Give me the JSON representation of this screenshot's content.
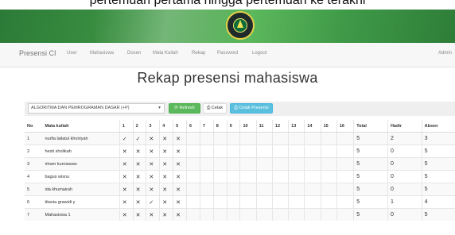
{
  "header": {
    "partial_text": "pertemuan pertama hingga pertemuan ke terakhi"
  },
  "navbar": {
    "brand": "Presensi CI",
    "items": [
      "User",
      "Mahasiswa",
      "Dosen",
      "Mata Kuliah",
      "Rekap",
      "Password",
      "Logout"
    ],
    "right_user": "Admin"
  },
  "page": {
    "title": "Rekap presensi mahasiswa"
  },
  "toolbar": {
    "course_select_value": "ALGORITMA DAN PEMROGRAMAN DASAR (+P)",
    "refresh_label": "Refresh",
    "cetak_label": "Cetak",
    "cetak_presensi_label": "Cetak Presensi"
  },
  "table": {
    "headers": [
      "No",
      "Mata kuliah",
      "1",
      "2",
      "3",
      "4",
      "5",
      "6",
      "7",
      "8",
      "9",
      "10",
      "11",
      "12",
      "13",
      "14",
      "15",
      "16",
      "Total",
      "Hadir",
      "Absen"
    ],
    "rows": [
      {
        "no": "1",
        "name": "nurlla lailatul khoiriyah",
        "marks": [
          "✓",
          "✓",
          "✕",
          "✕",
          "✕",
          "",
          "",
          "",
          "",
          "",
          "",
          "",
          "",
          "",
          "",
          ""
        ],
        "total": "5",
        "hadir": "2",
        "absen": "3"
      },
      {
        "no": "2",
        "name": "hesti sholikah",
        "marks": [
          "✕",
          "✕",
          "✕",
          "✕",
          "✕",
          "",
          "",
          "",
          "",
          "",
          "",
          "",
          "",
          "",
          "",
          ""
        ],
        "total": "5",
        "hadir": "0",
        "absen": "5"
      },
      {
        "no": "3",
        "name": "irham kurniawan",
        "marks": [
          "✕",
          "✕",
          "✕",
          "✕",
          "✕",
          "",
          "",
          "",
          "",
          "",
          "",
          "",
          "",
          "",
          "",
          ""
        ],
        "total": "5",
        "hadir": "0",
        "absen": "5"
      },
      {
        "no": "4",
        "name": "bagus wisnu",
        "marks": [
          "✕",
          "✕",
          "✕",
          "✕",
          "✕",
          "",
          "",
          "",
          "",
          "",
          "",
          "",
          "",
          "",
          "",
          ""
        ],
        "total": "5",
        "hadir": "0",
        "absen": "5"
      },
      {
        "no": "5",
        "name": "ida khumairah",
        "marks": [
          "✕",
          "✕",
          "✕",
          "✕",
          "✕",
          "",
          "",
          "",
          "",
          "",
          "",
          "",
          "",
          "",
          "",
          ""
        ],
        "total": "5",
        "hadir": "0",
        "absen": "5"
      },
      {
        "no": "6",
        "name": "titania grawidi y",
        "marks": [
          "✕",
          "✕",
          "✓",
          "✕",
          "✕",
          "",
          "",
          "",
          "",
          "",
          "",
          "",
          "",
          "",
          "",
          ""
        ],
        "total": "5",
        "hadir": "1",
        "absen": "4"
      },
      {
        "no": "7",
        "name": "Mahasiswa 1",
        "marks": [
          "✕",
          "✕",
          "✕",
          "✕",
          "✕",
          "",
          "",
          "",
          "",
          "",
          "",
          "",
          "",
          "",
          "",
          ""
        ],
        "total": "5",
        "hadir": "0",
        "absen": "5"
      }
    ]
  }
}
